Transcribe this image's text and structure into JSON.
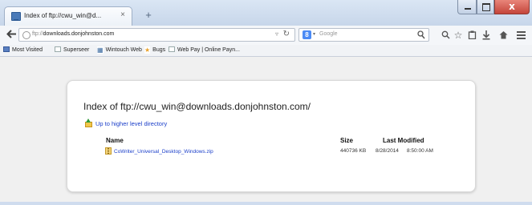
{
  "window": {
    "tab_title": "Index of ftp://cwu_win@d...",
    "tab_close": "×",
    "new_tab": "+",
    "close_glyph": "x"
  },
  "navbar": {
    "url_prefix": "ftp://",
    "url_host": "downloads.donjohnston.com",
    "search_engine_letter": "8",
    "search_placeholder": "Google",
    "icons": [
      "back-arrow-icon",
      "globe-icon",
      "reload-icon",
      "search-icon",
      "star-icon",
      "clipboard-icon",
      "download-icon",
      "home-icon",
      "menu-icon"
    ]
  },
  "bookmarks": [
    {
      "label": "Most Visited",
      "icon": "star"
    },
    {
      "label": "Superseer",
      "icon": "page"
    },
    {
      "label": "Wintouch Web",
      "icon": "grid"
    },
    {
      "label": "Bugs",
      "icon": "star"
    },
    {
      "label": "Web Pay | Online Payn...",
      "icon": "page"
    }
  ],
  "page": {
    "title": "Index of ftp://cwu_win@downloads.donjohnston.com/",
    "up_link": "Up to higher level directory",
    "columns": {
      "name": "Name",
      "size": "Size",
      "modified": "Last Modified"
    },
    "files": [
      {
        "name": "CoWriter_Universal_Desktop_Windows.zip",
        "size": "440736 KB",
        "date": "8/28/2014",
        "time": "8:50:00 AM"
      }
    ]
  },
  "colors": {
    "link": "#1a3ec9",
    "chrome": "#cfdcee",
    "close_button": "#c5453a"
  }
}
